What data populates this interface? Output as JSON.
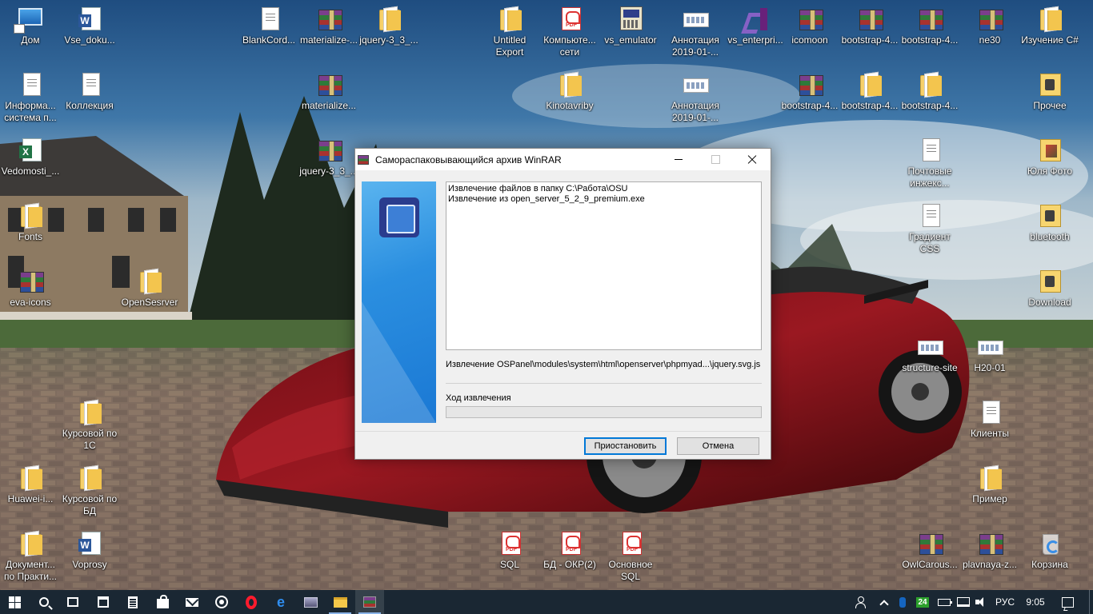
{
  "desktop": {
    "icons": [
      {
        "label": "Дом",
        "type": "pc"
      },
      {
        "label": "Vse_doku...",
        "type": "word"
      },
      {
        "label": "BlankCord...",
        "type": "vsdoc"
      },
      {
        "label": "materialize-...",
        "type": "rar"
      },
      {
        "label": "jquery-3_3_...",
        "type": "folder"
      },
      {
        "label": "Untitled Export",
        "type": "folder"
      },
      {
        "label": "Компьюте... сети",
        "type": "pdf"
      },
      {
        "label": "vs_emulator",
        "type": "emu"
      },
      {
        "label": "Аннотация 2019-01-...",
        "type": "img"
      },
      {
        "label": "vs_enterpri...",
        "type": "vs"
      },
      {
        "label": "icomoon",
        "type": "rar"
      },
      {
        "label": "bootstrap-4...",
        "type": "rar"
      },
      {
        "label": "bootstrap-4...",
        "type": "rar"
      },
      {
        "label": "ne30",
        "type": "rar"
      },
      {
        "label": "Изучение С#",
        "type": "folder"
      },
      {
        "label": "Информа... система п...",
        "type": "vsdoc"
      },
      {
        "label": "Коллекция",
        "type": "doc"
      },
      {
        "label": "materialize...",
        "type": "rar"
      },
      {
        "label": "Kinotavriby",
        "type": "folder"
      },
      {
        "label": "Аннотация 2019-01-...",
        "type": "img"
      },
      {
        "label": "bootstrap-4...",
        "type": "rar"
      },
      {
        "label": "bootstrap-4...",
        "type": "folder"
      },
      {
        "label": "bootstrap-4...",
        "type": "folder"
      },
      {
        "label": "Прочее",
        "type": "winfolder"
      },
      {
        "label": "Vedomosti_...",
        "type": "excel"
      },
      {
        "label": "jquery-3_3_...",
        "type": "rar"
      },
      {
        "label": "Почтовые инжекс...",
        "type": "doc"
      },
      {
        "label": "Юля Фото",
        "type": "photo"
      },
      {
        "label": "Fonts",
        "type": "folder"
      },
      {
        "label": "Градиент CSS",
        "type": "doc"
      },
      {
        "label": "bluetooth",
        "type": "winfolder"
      },
      {
        "label": "eva-icons",
        "type": "rar"
      },
      {
        "label": "OpenSesrver",
        "type": "folder"
      },
      {
        "label": "Download",
        "type": "winfolder"
      },
      {
        "label": "structure-site",
        "type": "img"
      },
      {
        "label": "H20-01",
        "type": "img"
      },
      {
        "label": "Курсовой по 1С",
        "type": "folder"
      },
      {
        "label": "Клиенты",
        "type": "doc"
      },
      {
        "label": "Huawei-i...",
        "type": "folder"
      },
      {
        "label": "Курсовой по БД",
        "type": "folder"
      },
      {
        "label": "Пример",
        "type": "folder"
      },
      {
        "label": "Документ... по Практи...",
        "type": "folder"
      },
      {
        "label": "Voprosy",
        "type": "word"
      },
      {
        "label": "SQL",
        "type": "pdf"
      },
      {
        "label": "БД - ОКР(2)",
        "type": "pdf"
      },
      {
        "label": "Основное SQL",
        "type": "pdf"
      },
      {
        "label": "OwlCarous...",
        "type": "rar"
      },
      {
        "label": "plavnaya-z...",
        "type": "rar"
      },
      {
        "label": "Корзина",
        "type": "trash"
      }
    ]
  },
  "dialog": {
    "title": "Самораспаковывающийся архив WinRAR",
    "log_lines": [
      "Извлечение файлов в папку C:\\Работа\\OSU",
      "Извлечение из open_server_5_2_9_premium.exe"
    ],
    "current_file": "Извлечение OSPanel\\modules\\system\\html\\openserver\\phpmyad...\\jquery.svg.js",
    "progress_label": "Ход извлечения",
    "progress_fraction": 0,
    "pause_button": "Приостановить",
    "cancel_button": "Отмена"
  },
  "taskbar": {
    "tray_badge": "24",
    "language": "РУС",
    "time": "9:05"
  },
  "colors": {
    "taskbar_bg": "#1a2733",
    "accent": "#0078d7",
    "banner_blue": "#1a78d4"
  }
}
